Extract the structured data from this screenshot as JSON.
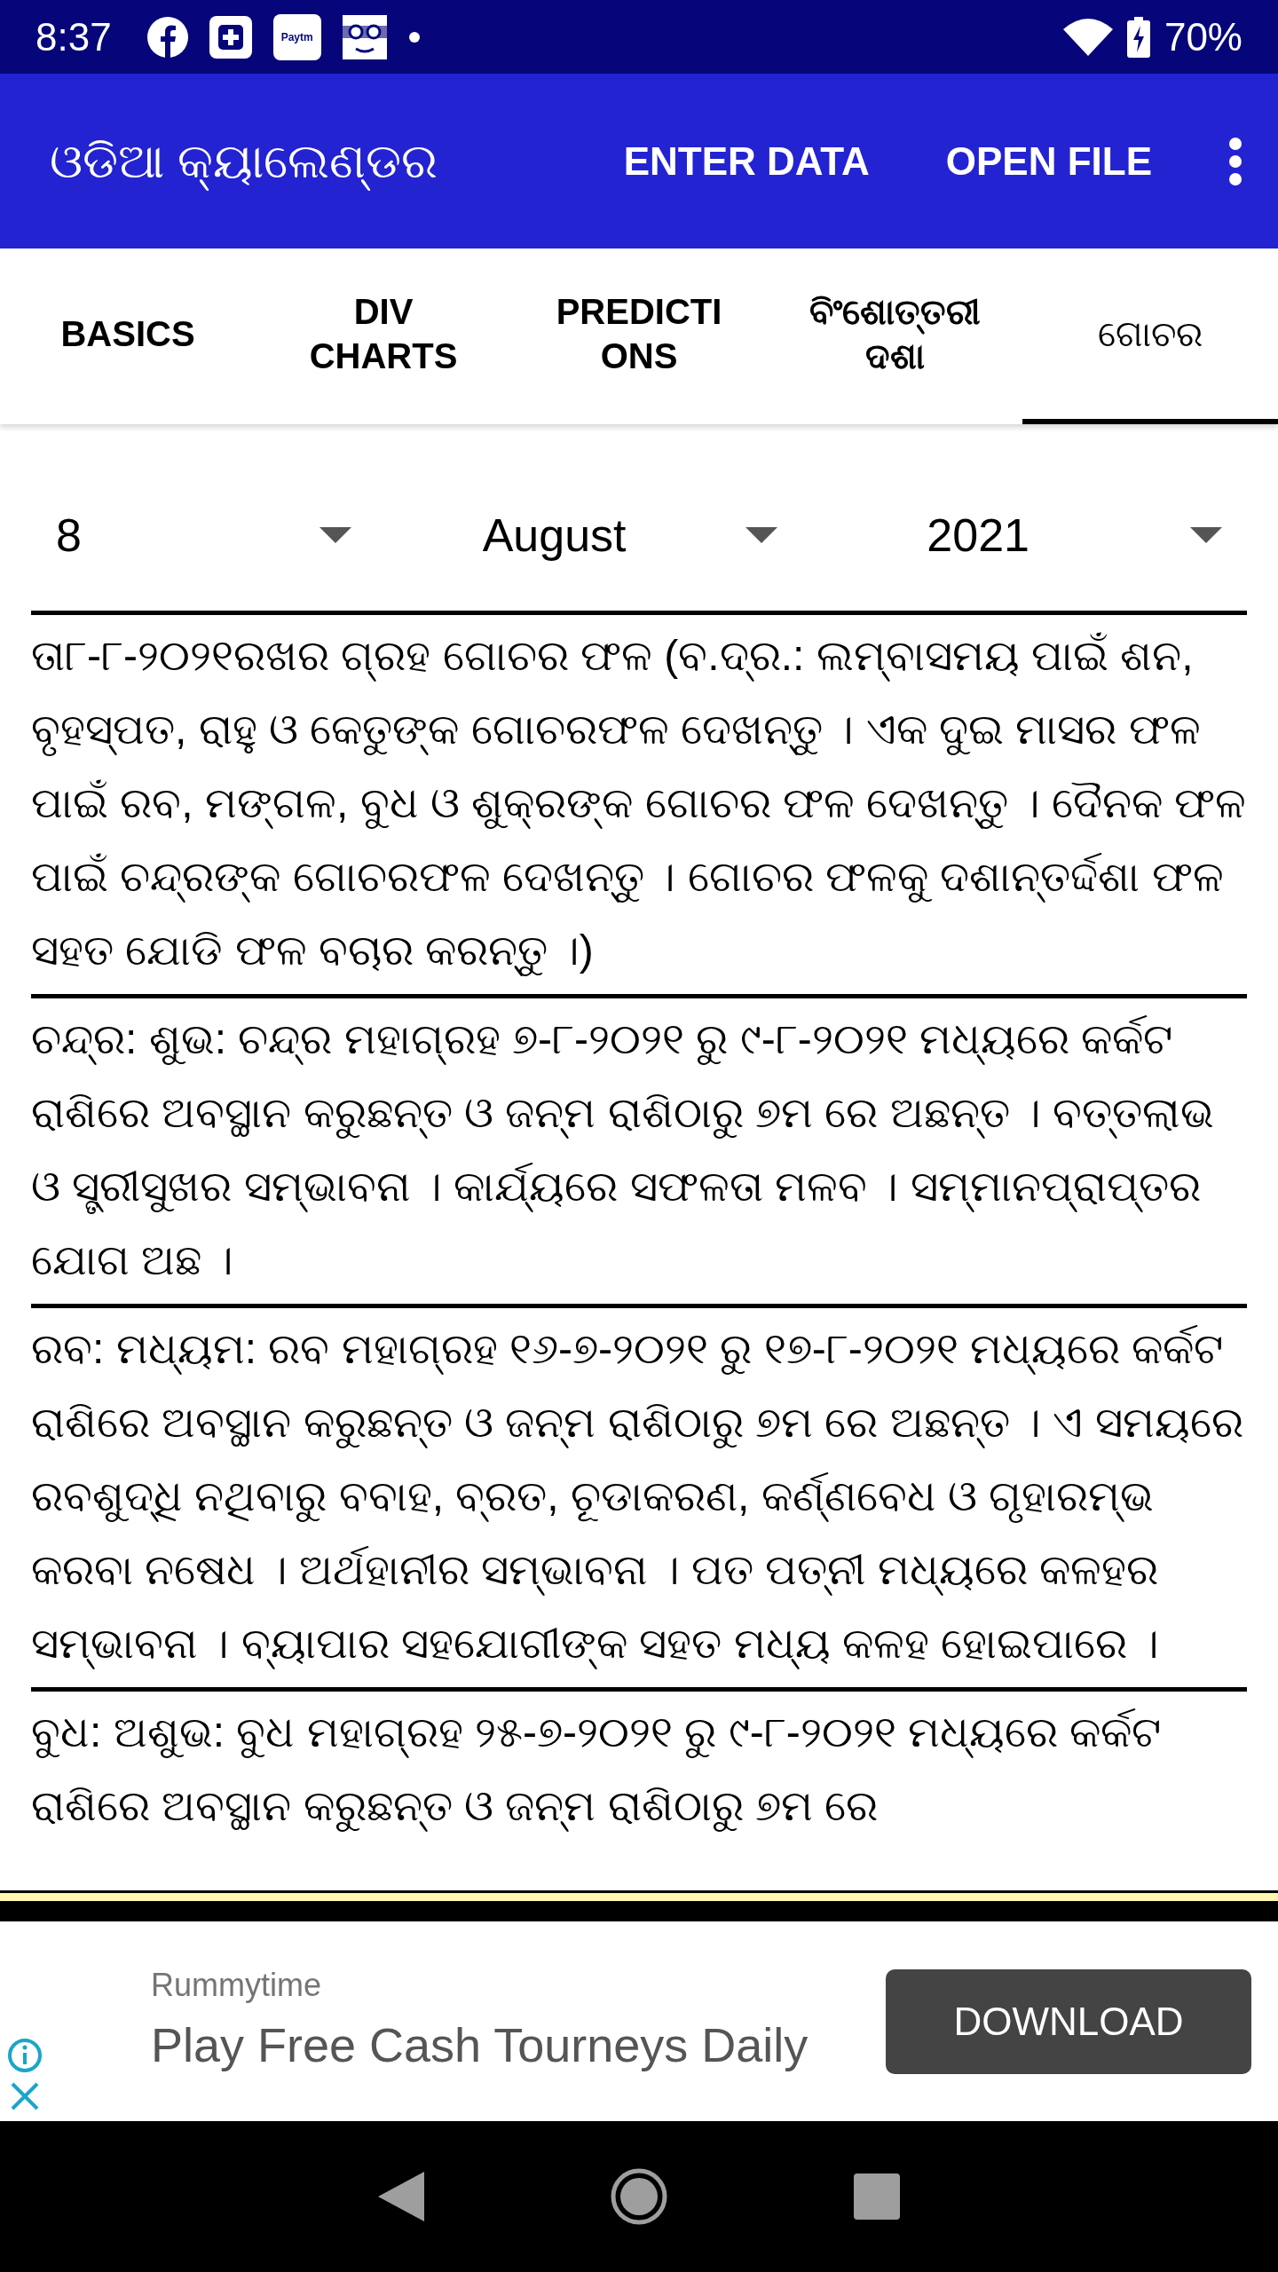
{
  "status_bar": {
    "time": "8:37",
    "paytm_label": "Paytm",
    "battery": "70%"
  },
  "app_bar": {
    "title": "ଓଡିଆ କ୍ୟାଲେଣ୍ଡର",
    "actions": [
      "ENTER DATA",
      "OPEN FILE"
    ]
  },
  "tabs": [
    {
      "label": "BASICS",
      "selected": false
    },
    {
      "label": "DIV CHARTS",
      "selected": false
    },
    {
      "label": "PREDICTIONS",
      "selected": false
    },
    {
      "label": "ବିଂଶୋତ୍ତରୀ ଦଶା",
      "selected": false
    },
    {
      "label": "ଗୋଚର",
      "selected": true
    }
  ],
  "dropdowns": [
    {
      "value": "8"
    },
    {
      "value": "August"
    },
    {
      "value": "2021"
    }
  ],
  "paragraphs": [
    "ତା୮-୮-୨୦୨୧ରଖର ଗ୍ରହ ଗୋଚର ଫଳ (ବ.ଦ୍ର.: ଲମ୍ବାସମୟ ପାଇଁ ଶନ, ବୃହସ୍ପତ, ରାହୁ ଓ କେତୁଙ୍କ ଗୋଚରଫଳ ଦେଖନ୍ତୁ । ଏକ ଦୁଇ ମାସର ଫଳ ପାଇଁ ରବ, ମଙ୍ଗଳ, ବୁଧ ଓ ଶୁକ୍ରଙ୍କ ଗୋଚର ଫଳ ଦେଖନ୍ତୁ । ଦୈନକ ଫଳ ପାଇଁ ଚନ୍ଦ୍ରଙ୍କ ଗୋଚରଫଳ ଦେଖନ୍ତୁ । ଗୋଚର ଫଳକୁ ଦଶାନ୍ତର୍ଦ୍ଦଶା ଫଳ ସହତ ଯୋଡି ଫଳ ବଚାର କରନ୍ତୁ ।)",
    "ଚନ୍ଦ୍ର: ଶୁଭ: ଚନ୍ଦ୍ର ମହାଗ୍ରହ ୭-୮-୨୦୨୧ ରୁ ୯-୮-୨୦୨୧ ମଧ୍ୟରେ କର୍କଟ ରାଶିରେ ଅବସ୍ଥାନ କରୁଛନ୍ତ ଓ ଜନ୍ମ ରାଶିଠାରୁ ୭ମ ରେ ଅଛନ୍ତ । ବତ୍ତଲାଭ ଓ ସ୍ତ୍ରୀସୁଖର ସମ୍ଭାବନା । କାର୍ଯ୍ୟରେ ସଫଳତା ମଳବ । ସମ୍ମାନପ୍ରାପ୍ତର ଯୋଗ ଅଛ ।",
    "ରବ: ମଧ୍ୟମ: ରବ ମହାଗ୍ରହ ୧୬-୭-୨୦୨୧ ରୁ ୧୭-୮-୨୦୨୧ ମଧ୍ୟରେ କର୍କଟ ରାଶିରେ ଅବସ୍ଥାନ କରୁଛନ୍ତ ଓ ଜନ୍ମ ରାଶିଠାରୁ ୭ମ ରେ ଅଛନ୍ତ । ଏ ସମୟରେ ରବଶୁଦ୍ଧି ନଥିବାରୁ ବବାହ, ବ୍ରତ, ଚୂଡାକରଣ, କର୍ଣ୍ଣବେଧ ଓ ଗୃହାରମ୍ଭ କରବା ନଷେଧ । ଅର୍ଥହାନୀର ସମ୍ଭାବନା । ପତ ପତ୍ନୀ ମଧ୍ୟରେ କଳହର ସମ୍ଭାବନା । ବ୍ୟାପାର ସହଯୋଗୀଙ୍କ ସହତ ମଧ୍ୟ କଳହ ହୋଇପାରେ ।",
    "ବୁଧ: ଅଶୁଭ: ବୁଧ ମହାଗ୍ରହ ୨୫-୭-୨୦୨୧ ରୁ ୯-୮-୨୦୨୧ ମଧ୍ୟରେ କର୍କଟ ରାଶିରେ ଅବସ୍ଥାନ କରୁଛନ୍ତ ଓ ଜନ୍ମ ରାଶିଠାରୁ ୭ମ ରେ"
  ],
  "ad": {
    "advertiser": "Rummytime",
    "headline": "Play Free Cash Tourneys Daily",
    "cta": "DOWNLOAD"
  }
}
